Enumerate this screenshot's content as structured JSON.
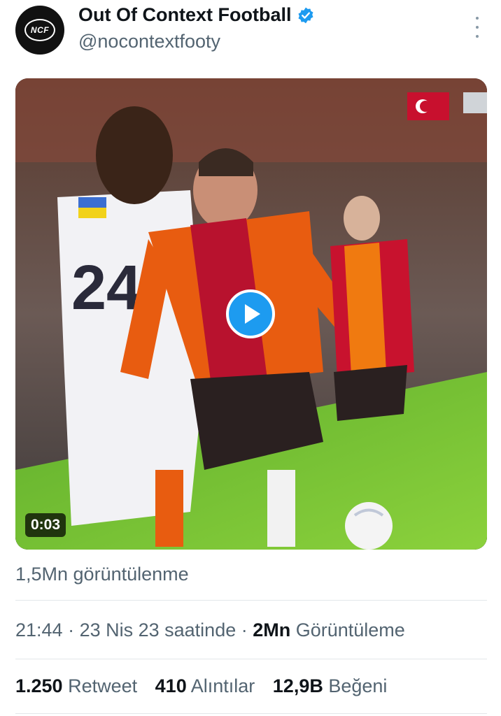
{
  "account": {
    "display_name": "Out Of Context Football",
    "handle": "@nocontextfooty",
    "avatar_text": "NCF",
    "verified_icon": "verified-badge-icon",
    "menu_icon": "more-options-icon"
  },
  "media": {
    "duration": "0:03",
    "play_icon": "play-icon"
  },
  "views_text": "1,5Mn görüntülenme",
  "meta": {
    "time": "21:44",
    "sep1": " · ",
    "date": "23 Nis 23 saatinde",
    "sep2": " · ",
    "views_count": "2Mn",
    "views_label": " Görüntüleme"
  },
  "stats": {
    "retweets_count": "1.250",
    "retweets_label": " Retweet",
    "quotes_count": "410",
    "quotes_label": " Alıntılar",
    "likes_count": "12,9B",
    "likes_label": " Beğeni"
  },
  "colors": {
    "accent": "#1d9bf0",
    "secondary_text": "#536471",
    "primary_text": "#0f1419",
    "divider": "#e3e7ea"
  }
}
